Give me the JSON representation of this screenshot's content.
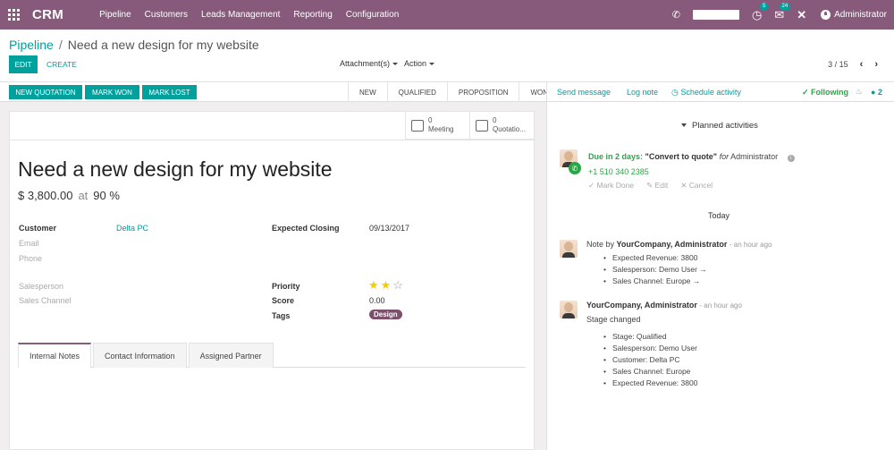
{
  "navbar": {
    "brand": "CRM",
    "menu": [
      "Pipeline",
      "Customers",
      "Leads Management",
      "Reporting",
      "Configuration"
    ],
    "activity_badge": "5",
    "messages_badge": "24",
    "user": "Administrator"
  },
  "control_panel": {
    "breadcrumb_parent": "Pipeline",
    "breadcrumb_sep": "/",
    "breadcrumb_current": "Need a new design for my website",
    "edit_label": "EDIT",
    "create_label": "CREATE",
    "attachments_label": "Attachment(s)",
    "action_label": "Action",
    "pager": "3 / 15"
  },
  "statusbar": {
    "buttons": [
      "NEW QUOTATION",
      "MARK WON",
      "MARK LOST"
    ],
    "stages": [
      "NEW",
      "QUALIFIED",
      "PROPOSITION",
      "WON"
    ]
  },
  "smart_buttons": [
    {
      "count": "0",
      "label": "Meeting"
    },
    {
      "count": "0",
      "label": "Quotatio..."
    }
  ],
  "lead": {
    "title": "Need a new design for my website",
    "revenue": "$ 3,800.00",
    "at": "at",
    "probability": "90 %",
    "customer_label": "Customer",
    "customer": "Delta PC",
    "email_label": "Email",
    "phone_label": "Phone",
    "salesperson_label": "Salesperson",
    "sales_channel_label": "Sales Channel",
    "expected_closing_label": "Expected Closing",
    "expected_closing": "09/13/2017",
    "priority_label": "Priority",
    "priority_stars": 2,
    "priority_max": 3,
    "score_label": "Score",
    "score": "0.00",
    "tags_label": "Tags",
    "tag": "Design"
  },
  "notebook_tabs": [
    "Internal Notes",
    "Contact Information",
    "Assigned Partner"
  ],
  "chatter": {
    "send_message": "Send message",
    "log_note": "Log note",
    "schedule_activity": "Schedule activity",
    "following": "Following",
    "followers_count": "2",
    "planned_title": "Planned activities",
    "activity": {
      "due": "Due in 2 days:",
      "summary": "\"Convert to quote\"",
      "for": "for",
      "assignee": "Administrator",
      "phone": "+1 510 340 2385",
      "mark_done": "Mark Done",
      "edit": "Edit",
      "cancel": "Cancel"
    },
    "today": "Today",
    "message1": {
      "prefix": "Note by",
      "author": "YourCompany, Administrator",
      "time": "- an hour ago",
      "values": [
        "Expected Revenue: 3800",
        "Salesperson: Demo User →",
        "Sales Channel: Europe →"
      ]
    },
    "message2": {
      "author": "YourCompany, Administrator",
      "time": "- an hour ago",
      "body": "Stage changed",
      "values": [
        "Stage: Qualified",
        "Salesperson: Demo User",
        "Customer: Delta PC",
        "Sales Channel: Europe",
        "Expected Revenue: 3800"
      ]
    }
  }
}
